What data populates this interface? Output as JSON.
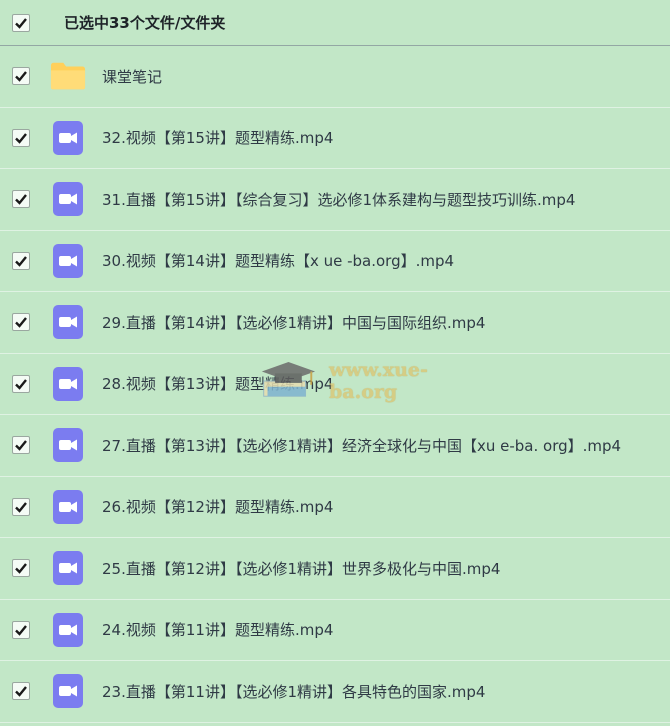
{
  "header": {
    "selection_text": "已选中33个文件/文件夹"
  },
  "files": [
    {
      "name": "课堂笔记",
      "type": "folder",
      "checked": true
    },
    {
      "name": "32.视频【第15讲】题型精练.mp4",
      "type": "video",
      "checked": true
    },
    {
      "name": "31.直播【第15讲】【综合复习】选必修1体系建构与题型技巧训练.mp4",
      "type": "video",
      "checked": true
    },
    {
      "name": "30.视频【第14讲】题型精练【x ue -ba.org】.mp4",
      "type": "video",
      "checked": true
    },
    {
      "name": "29.直播【第14讲】【选必修1精讲】中国与国际组织.mp4",
      "type": "video",
      "checked": true
    },
    {
      "name": "28.视频【第13讲】题型精练.mp4",
      "type": "video",
      "checked": true
    },
    {
      "name": "27.直播【第13讲】【选必修1精讲】经济全球化与中国【xu e-ba. org】.mp4",
      "type": "video",
      "checked": true
    },
    {
      "name": "26.视频【第12讲】题型精练.mp4",
      "type": "video",
      "checked": true
    },
    {
      "name": "25.直播【第12讲】【选必修1精讲】世界多极化与中国.mp4",
      "type": "video",
      "checked": true
    },
    {
      "name": "24.视频【第11讲】题型精练.mp4",
      "type": "video",
      "checked": true
    },
    {
      "name": "23.直播【第11讲】【选必修1精讲】各具特色的国家.mp4",
      "type": "video",
      "checked": true
    }
  ],
  "watermark": {
    "text": "www.xue-ba.org"
  },
  "colors": {
    "background": "#c2e7c7",
    "video_icon": "#7b7cf0",
    "folder_icon": "#ffd05a"
  }
}
